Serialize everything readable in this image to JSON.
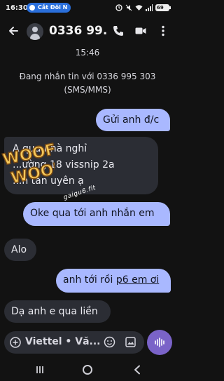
{
  "status_bar": {
    "time": "16:30",
    "chip_label": "Cắt Đôi N",
    "battery": "69"
  },
  "header": {
    "contact": "0336 99..."
  },
  "thread": {
    "timestamp": "15:46",
    "sms_note_line1": "Đang nhắn tin với 0336 995 303",
    "sms_note_line2": "(SMS/MMS)",
    "messages": [
      {
        "direction": "out",
        "text": "Gửi anh đ/c"
      },
      {
        "direction": "in",
        "lines": [
          "A qua nhà nghỉ",
          "...ường 18 vissnip 2a",
          "...n tân uyên ạ"
        ]
      },
      {
        "direction": "out",
        "text": "Oke qua tới anh nhắn em"
      },
      {
        "direction": "in",
        "text": "Alo"
      },
      {
        "direction": "out",
        "text_plain": "anh tới rồi ",
        "text_link": "p6 em ơi"
      },
      {
        "direction": "in",
        "text": "Dạ anh e qua liền"
      }
    ]
  },
  "watermark": {
    "sticker_line1": "WOOF",
    "sticker_line2": "WOOF",
    "url": "gaigu6.fit"
  },
  "compose": {
    "text": "Viettel • Vă..."
  },
  "colors": {
    "background": "#121212",
    "outgoing_bubble": "#a9b8ff",
    "incoming_bubble": "#2b2d34",
    "mic_button": "#7a63c8"
  }
}
